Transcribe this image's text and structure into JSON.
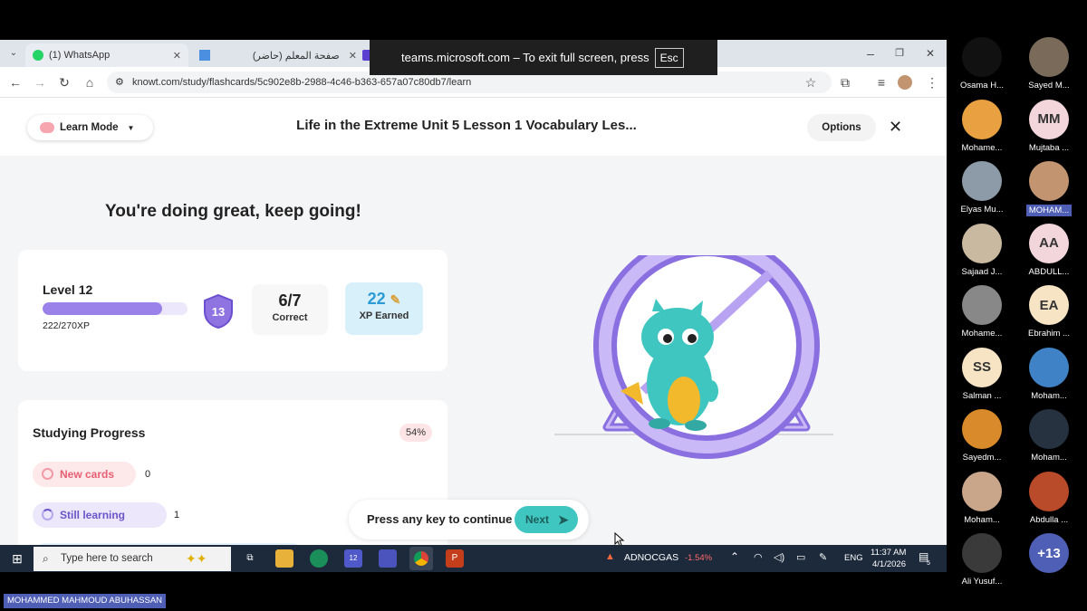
{
  "browser": {
    "tabs": [
      {
        "label": "(1) WhatsApp"
      },
      {
        "label": "صفحة المعلم (حاضر)"
      }
    ],
    "url": "knowt.com/study/flashcards/5c902e8b-2988-4c46-b363-657a07c80db7/learn",
    "fullscreen_banner": "teams.microsoft.com – To exit full screen, press",
    "fullscreen_key": "Esc"
  },
  "knowt": {
    "mode_label": "Learn Mode",
    "title": "Life in the Extreme Unit 5 Lesson 1 Vocabulary Les...",
    "options_label": "Options",
    "encouragement": "You're doing great, keep going!",
    "level_label": "Level 12",
    "level_progress": 0.822,
    "xp_text": "222/270XP",
    "next_level": "13",
    "correct_value": "6/7",
    "correct_label": "Correct",
    "xp_earned_value": "22",
    "xp_earned_label": "XP Earned",
    "progress_title": "Studying Progress",
    "progress_percent": "54%",
    "new_cards_label": "New cards",
    "new_cards_count": "0",
    "still_learning_label": "Still learning",
    "still_learning_count": "1",
    "continue_text": "Press any key to continue",
    "next_label": "Next"
  },
  "taskbar": {
    "search_placeholder": "Type here to search",
    "ticker_name": "ADNOCGAS",
    "ticker_change": "-1.54%",
    "language": "ENG",
    "time": "11:37 AM",
    "date": "4/1/2026",
    "teams_badge": "12",
    "notification_count": "5"
  },
  "participants": [
    {
      "name": "Osama H...",
      "initials": "",
      "color": "#111111"
    },
    {
      "name": "Sayed M...",
      "initials": "",
      "color": "#7a6a5a"
    },
    {
      "name": "Mohame...",
      "initials": "",
      "color": "#e8a040"
    },
    {
      "name": "Mujtaba ...",
      "initials": "MM",
      "color": "#f2d6dc"
    },
    {
      "name": "Elyas Mu...",
      "initials": "",
      "color": "#8d9aa8"
    },
    {
      "name": "MOHAM...",
      "initials": "",
      "color": "#c29470"
    },
    {
      "name": "Sajaad J...",
      "initials": "",
      "color": "#c9b9a0"
    },
    {
      "name": "ABDULL...",
      "initials": "AA",
      "color": "#f2d6dc"
    },
    {
      "name": "Mohame...",
      "initials": "",
      "color": "#888888"
    },
    {
      "name": "Ebrahim ...",
      "initials": "EA",
      "color": "#f6e4c4"
    },
    {
      "name": "Salman ...",
      "initials": "SS",
      "color": "#f6e4c4"
    },
    {
      "name": "Moham...",
      "initials": "",
      "color": "#3f83c6"
    },
    {
      "name": "Sayedm...",
      "initials": "",
      "color": "#d98a2a"
    },
    {
      "name": "Moham...",
      "initials": "",
      "color": "#26323f"
    },
    {
      "name": "Moham...",
      "initials": "",
      "color": "#c9a58a"
    },
    {
      "name": "Abdulla ...",
      "initials": "",
      "color": "#b94a2a"
    },
    {
      "name": "Ali Yusuf...",
      "initials": "",
      "color": "#3a3a3a"
    },
    {
      "name": "",
      "initials": "+13",
      "color": "#4f5fb5"
    }
  ],
  "presenter_name": "MOHAMMED MAHMOUD ABUHASSAN"
}
